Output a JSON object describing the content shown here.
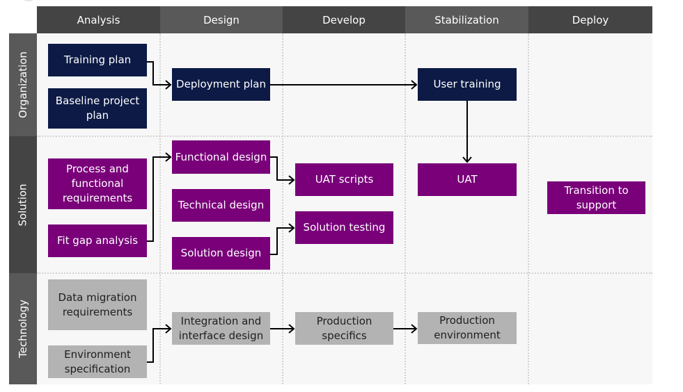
{
  "phases": [
    {
      "label": "Analysis"
    },
    {
      "label": "Design"
    },
    {
      "label": "Develop"
    },
    {
      "label": "Stabilization"
    },
    {
      "label": "Deploy"
    }
  ],
  "lanes": [
    {
      "label": "Organization"
    },
    {
      "label": "Solution"
    },
    {
      "label": "Technology"
    }
  ],
  "colors": {
    "organization_box": "#0c1a45",
    "solution_box": "#790079",
    "technology_box": "#b3b3b3",
    "header_dark": "#444444",
    "header_light": "#595959",
    "background": "#f7f7f7"
  },
  "boxes": {
    "training_plan": "Training plan",
    "baseline_project_plan": "Baseline project plan",
    "deployment_plan": "Deployment plan",
    "user_training": "User training",
    "process_functional_requirements": "Process and functional requirements",
    "fit_gap_analysis": "Fit gap analysis",
    "functional_design": "Functional design",
    "technical_design": "Technical design",
    "solution_design": "Solution design",
    "uat_scripts": "UAT scripts",
    "solution_testing": "Solution testing",
    "uat": "UAT",
    "transition_to_support": "Transition to support",
    "data_migration_requirements": "Data migration requirements",
    "environment_specification": "Environment specification",
    "integration_interface_design": "Integration and interface design",
    "production_specifics": "Production specifics",
    "production_environment": "Production environment"
  },
  "connections": [
    {
      "from": "Training plan",
      "to": "Deployment plan"
    },
    {
      "from": "Deployment plan",
      "to": "User training"
    },
    {
      "from": "User training",
      "to": "UAT"
    },
    {
      "from": "Fit gap analysis",
      "to": "Functional design"
    },
    {
      "from": "Functional design",
      "to": "UAT scripts"
    },
    {
      "from": "Solution design",
      "to": "Solution testing"
    },
    {
      "from": "Environment specification",
      "to": "Integration and interface design"
    },
    {
      "from": "Integration and interface design",
      "to": "Production specifics"
    },
    {
      "from": "Production specifics",
      "to": "Production environment"
    }
  ]
}
